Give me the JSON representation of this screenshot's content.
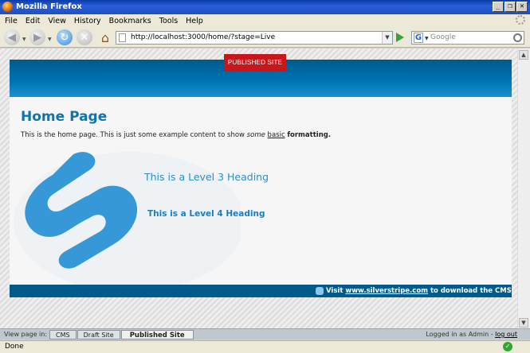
{
  "window": {
    "title": "Mozilla Firefox",
    "buttons": {
      "minimize": "_",
      "restore": "❐",
      "close": "✕"
    }
  },
  "menu": [
    "File",
    "Edit",
    "View",
    "History",
    "Bookmarks",
    "Tools",
    "Help"
  ],
  "navbar": {
    "url": "http://localhost:3000/home/?stage=Live",
    "search_engine": "G",
    "search_placeholder": "Google"
  },
  "page": {
    "badge": "PUBLISHED SITE",
    "title": "Home Page",
    "intro": {
      "part1": "This is the home page. This is just some example content to show ",
      "italic": "some",
      "underline": "basic",
      "bold": "formatting."
    },
    "h3": "This is a Level 3 Heading",
    "h4": "This is a Level 4 Heading",
    "footer": {
      "prefix": "Visit ",
      "link": "www.silverstripe.com",
      "suffix": " to download the CMS"
    }
  },
  "cms_bar": {
    "label": "View page in:",
    "tabs": [
      "CMS",
      "Draft Site",
      "Published Site"
    ],
    "active_tab": "Published Site",
    "login_text": "Logged in as Admin - ",
    "logout": "log out"
  },
  "status": {
    "text": "Done"
  },
  "colors": {
    "brand_blue": "#0076b5",
    "badge_red": "#c8161d",
    "heading_blue": "#0f74ae"
  }
}
